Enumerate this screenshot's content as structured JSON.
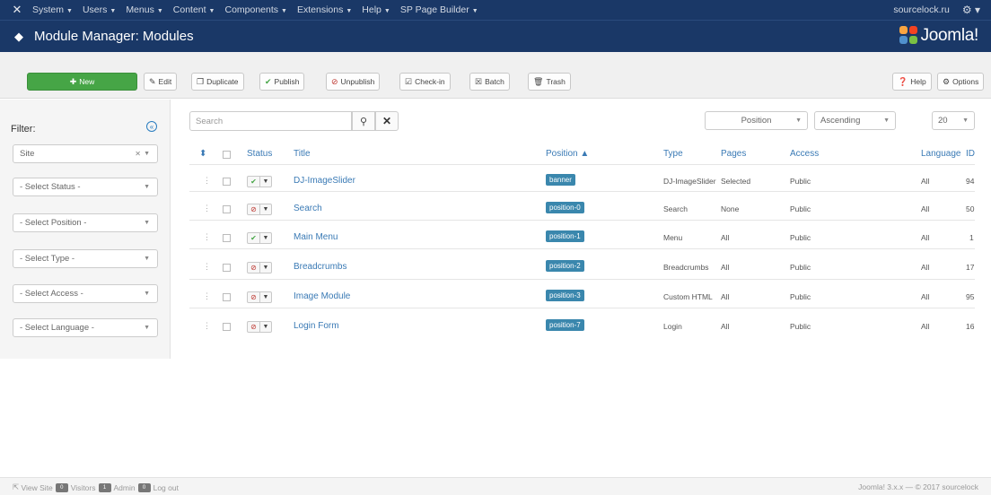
{
  "topnav": {
    "items": [
      "System",
      "Users",
      "Menus",
      "Content",
      "Components",
      "Extensions",
      "Help",
      "SP Page Builder"
    ],
    "user": "sourcelock.ru"
  },
  "header": {
    "title": "Module Manager: Modules",
    "brand": "Joomla!"
  },
  "toolbar": {
    "new": "New",
    "edit": "Edit",
    "duplicate": "Duplicate",
    "publish": "Publish",
    "unpublish": "Unpublish",
    "checkin": "Check-in",
    "batch": "Batch",
    "trash": "Trash",
    "help": "Help",
    "options": "Options"
  },
  "sidebar": {
    "filter_label": "Filter:",
    "filters": [
      "Site",
      "- Select Status -",
      "- Select Position -",
      "- Select Type -",
      "- Select Access -",
      "- Select Language -"
    ]
  },
  "search": {
    "placeholder": "Search"
  },
  "sort": {
    "position": "Position",
    "order": "Ascending",
    "limit": "20"
  },
  "table": {
    "columns": {
      "status": "Status",
      "title": "Title",
      "position": "Position",
      "type": "Type",
      "pages": "Pages",
      "access": "Access",
      "language": "Language",
      "id": "ID"
    },
    "rows": [
      {
        "published": true,
        "title": "DJ-ImageSlider",
        "position": "banner",
        "type": "DJ-ImageSlider",
        "pages": "Selected",
        "access": "Public",
        "language": "All",
        "id": "94"
      },
      {
        "published": false,
        "title": "Search",
        "position": "position-0",
        "type": "Search",
        "pages": "None",
        "access": "Public",
        "language": "All",
        "id": "50"
      },
      {
        "published": true,
        "title": "Main Menu",
        "position": "position-1",
        "type": "Menu",
        "pages": "All",
        "access": "Public",
        "language": "All",
        "id": "1"
      },
      {
        "published": false,
        "title": "Breadcrumbs",
        "position": "position-2",
        "type": "Breadcrumbs",
        "pages": "All",
        "access": "Public",
        "language": "All",
        "id": "17"
      },
      {
        "published": false,
        "title": "Image Module",
        "position": "position-3",
        "type": "Custom HTML",
        "pages": "All",
        "access": "Public",
        "language": "All",
        "id": "95"
      },
      {
        "published": false,
        "title": "Login Form",
        "position": "position-7",
        "type": "Login",
        "pages": "All",
        "access": "Public",
        "language": "All",
        "id": "16"
      }
    ]
  },
  "footer": {
    "left": "View Site",
    "left_visitors": "Visitors",
    "left_admin": "Admin",
    "left_logout": "Log out",
    "right": "Joomla! 3.x.x — © 2017 sourcelock"
  }
}
